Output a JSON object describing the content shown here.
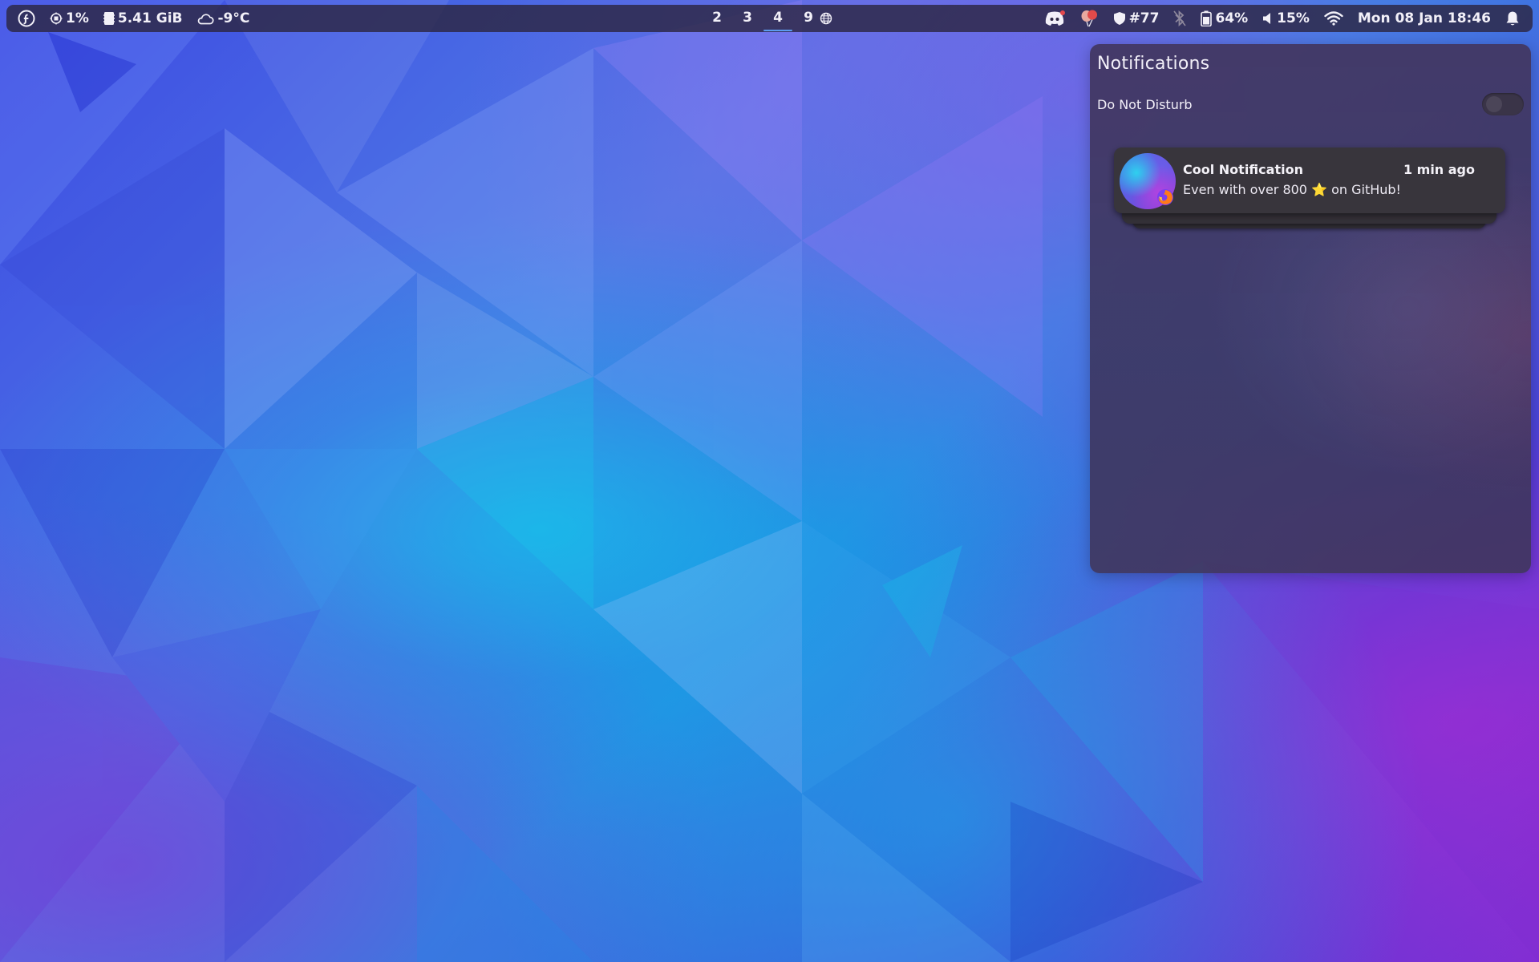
{
  "topbar": {
    "launcher_icon": "fedora-icon",
    "cpu": {
      "icon": "cpu-icon",
      "value": "1%"
    },
    "memory": {
      "icon": "memory-icon",
      "value": "5.41 GiB"
    },
    "weather": {
      "icon": "cloud-icon",
      "value": "-9°C"
    },
    "workspaces": [
      {
        "label": "2",
        "active": false
      },
      {
        "label": "3",
        "active": false
      },
      {
        "label": "4",
        "active": true
      },
      {
        "label": "9",
        "active": false
      }
    ],
    "workspace_special_icon": "globe-icon",
    "tray": [
      {
        "name": "discord-icon"
      },
      {
        "name": "balloon-icon"
      }
    ],
    "vpn": {
      "icon": "shield-icon",
      "value": "#77"
    },
    "bluetooth": {
      "icon": "bluetooth-off-icon"
    },
    "battery": {
      "icon": "battery-icon",
      "value": "64%"
    },
    "volume": {
      "icon": "speaker-icon",
      "value": "15%"
    },
    "wifi": {
      "icon": "wifi-icon"
    },
    "clock": "Mon 08 Jan 18:46",
    "notifications_icon": "bell-icon"
  },
  "notification_center": {
    "title": "Notifications",
    "dnd_label": "Do Not Disturb",
    "dnd_enabled": false,
    "notifications": [
      {
        "title": "Cool Notification",
        "time": "1 min ago",
        "body": "Even with over 800 ⭐ on GitHub!",
        "app_icon": "firefox-icon"
      }
    ]
  },
  "colors": {
    "bar_bg": "#2c2642",
    "workspace_active_underline": "#5c9cf0",
    "panel_bg": "#423660",
    "card_bg": "#38353c"
  }
}
